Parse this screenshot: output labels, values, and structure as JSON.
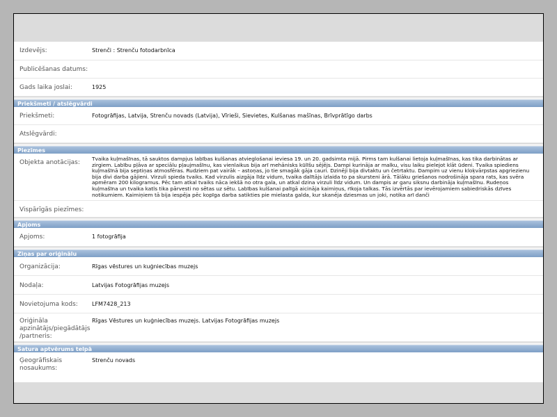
{
  "rows_top": [
    {
      "label": "Izdevējs:",
      "value": "Strenči : Strenču fotodarbnīca"
    },
    {
      "label": "Publicēšanas datums:",
      "value": ""
    },
    {
      "label": "Gads laika joslai:",
      "value": "1925"
    }
  ],
  "sections": {
    "subjects": {
      "title": "Priekšmeti / atslēgvārdi",
      "rows": [
        {
          "label": "Priekšmeti:",
          "value": "Fotogrāfijas, Latvija, Strenču novads (Latvija), Vīrieši, Sievietes, Kulšanas mašīnas, Brīvprātīgo darbs"
        },
        {
          "label": "Atslēgvārdi:",
          "value": ""
        }
      ]
    },
    "notes": {
      "title": "Piezīmes",
      "rows": [
        {
          "label": "Objekta anotācijas:",
          "value": "Tvaika kuļmašīnas, tā sauktos dampjus labības kulšanas atvieglošanai ieviesa 19. un 20. gadsimta mijā. Pirms tam kulšanai lietoja kuļmašīnas, kas tika darbinātas ar zirgiem. Labību pļāva ar speciālu pļaujmašīnu, kas vienlaikus bija arī mehānisks kūlīšu sējējs. Dampi kurināja ar malku, visu laiku pielejot klāt ūdeni. Tvaika spiediens kuļmašīnā bija septiņas atmosfēras. Rudziem pat vairāk – astoņas, jo tie smagāk gāja cauri. Dzinēji bija divtaktu un četrtaktu. Dampim uz vienu kloķvārpstas apgriezienu bija divi darba gājieni. Virzuli spieda tvaiks. Kad virzulis aizgāja līdz vidum, tvaika dalītājs izlaida to pa skursteni ārā. Tālāku griešanos nodrošināja spara rats, kas svēra apmēram 200 kilogramus. Pēc tam atkal tvaiks nāca iekšā no otra gala, un atkal dzina virzuli līdz vidum. Un dampis ar garu siksnu darbināja kuļmašīnu. Rudeņos kuļmašīna un tvaika katls tika pārvesti no sētas uz sētu. Labības kulšanai palīgā aicināja kaimiņus, rīkoja talkas. Tās izvērtās par ievērojamiem sabiedriskās dzīves notikumiem. Kaimiņiem tā bija iespēja pēc kopīga darba satikties pie mielasta galda, kur skanēja dziesmas un joki, notika arī danči"
        },
        {
          "label": "Vispārīgās piezīmes:",
          "value": ""
        }
      ]
    },
    "extent": {
      "title": "Apjoms",
      "rows": [
        {
          "label": "Apjoms:",
          "value": "1 fotogrāfija"
        }
      ]
    },
    "original": {
      "title": "Ziņas par oriģinālu",
      "rows": [
        {
          "label": "Organizācija:",
          "value": "Rīgas vēstures un kuģniecības muzejs"
        },
        {
          "label": "Nodaļa:",
          "value": "Latvijas Fotogrāfijas muzejs"
        },
        {
          "label": "Novietojuma kods:",
          "value": "LFM7428_213"
        },
        {
          "label": "Oriģināla apzinātājs/piegādātājs /partneris:",
          "value": "Rīgas Vēstures un kuģniecības muzejs. Latvijas Fotogrāfijas muzejs"
        }
      ]
    },
    "coverage": {
      "title": "Satura aptvērums telpā",
      "rows": [
        {
          "label": "Ģeogrāfiskais nosaukums:",
          "value": "Strenču novads"
        }
      ]
    }
  }
}
